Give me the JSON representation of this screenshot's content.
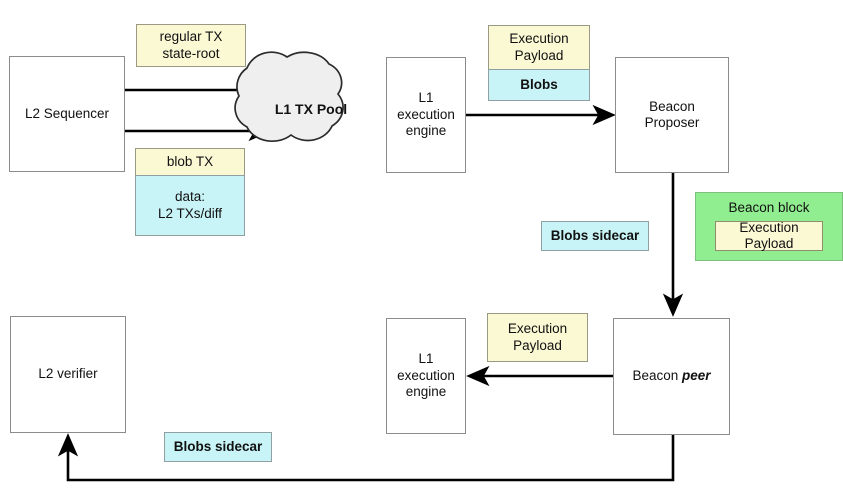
{
  "diagram": {
    "title": "EIP-4844 blob data flow between L2 sequencer, L1 execution engine and beacon chain",
    "colors": {
      "yellow": "#fbf8d4",
      "cyan": "#c9f4f7",
      "green": "#90ee90",
      "cloud": "#efefef",
      "box_border": "#8c8c8c",
      "edge": "#000000",
      "background": "#ffffff"
    },
    "nodes": {
      "l2_sequencer": {
        "label": "L2 Sequencer",
        "shape": "rect",
        "fill": "white"
      },
      "regular_tx": {
        "label": "regular TX\nstate-root",
        "shape": "rect",
        "fill": "yellow"
      },
      "blob_tx_header": {
        "label": "blob TX",
        "shape": "rect",
        "fill": "yellow"
      },
      "blob_tx_body": {
        "label": "data:\nL2 TXs/diff",
        "shape": "rect",
        "fill": "cyan"
      },
      "l1_tx_pool": {
        "label": "L1 TX Pool",
        "shape": "cloud",
        "fill": "cloud"
      },
      "l1_execution_engine_top": {
        "label": "L1\nexecution\nengine",
        "shape": "rect",
        "fill": "white"
      },
      "payload_top": {
        "label": "Execution\nPayload",
        "shape": "rect",
        "fill": "yellow"
      },
      "blobs_top": {
        "label": "Blobs",
        "shape": "rect",
        "fill": "cyan"
      },
      "beacon_proposer": {
        "label": "Beacon\nProposer",
        "shape": "rect",
        "fill": "white"
      },
      "blobs_sidecar_top": {
        "label": "Blobs sidecar",
        "shape": "rect",
        "fill": "cyan"
      },
      "beacon_block": {
        "label": "Beacon block",
        "inner_label": "Execution\nPayload",
        "shape": "rect",
        "fill": "green"
      },
      "beacon_peer": {
        "label_prefix": "Beacon ",
        "label_emphasis": "peer",
        "shape": "rect",
        "fill": "white"
      },
      "payload_bottom": {
        "label": "Execution\nPayload",
        "shape": "rect",
        "fill": "yellow"
      },
      "l1_execution_engine_bottom": {
        "label": "L1\nexecution\nengine",
        "shape": "rect",
        "fill": "white"
      },
      "l2_verifier": {
        "label": "L2 verifier",
        "shape": "rect",
        "fill": "white"
      },
      "blobs_sidecar_bottom": {
        "label": "Blobs sidecar",
        "shape": "rect",
        "fill": "cyan"
      }
    },
    "edges": [
      {
        "from": "l2_sequencer",
        "to": "l1_tx_pool",
        "style": "arrow",
        "note": "regular TX state-root"
      },
      {
        "from": "l2_sequencer",
        "to": "l1_tx_pool",
        "style": "arrow",
        "note": "blob TX"
      },
      {
        "from": "l1_execution_engine_top",
        "to": "beacon_proposer",
        "style": "arrow",
        "note": "Execution Payload + Blobs"
      },
      {
        "from": "beacon_proposer",
        "to": "beacon_peer",
        "style": "arrow",
        "note": "Blobs sidecar / Beacon block"
      },
      {
        "from": "beacon_peer",
        "to": "l1_execution_engine_bottom",
        "style": "arrow",
        "note": "Execution Payload"
      },
      {
        "from": "beacon_peer",
        "to": "l2_verifier",
        "style": "arrow",
        "note": "Blobs sidecar"
      }
    ]
  }
}
